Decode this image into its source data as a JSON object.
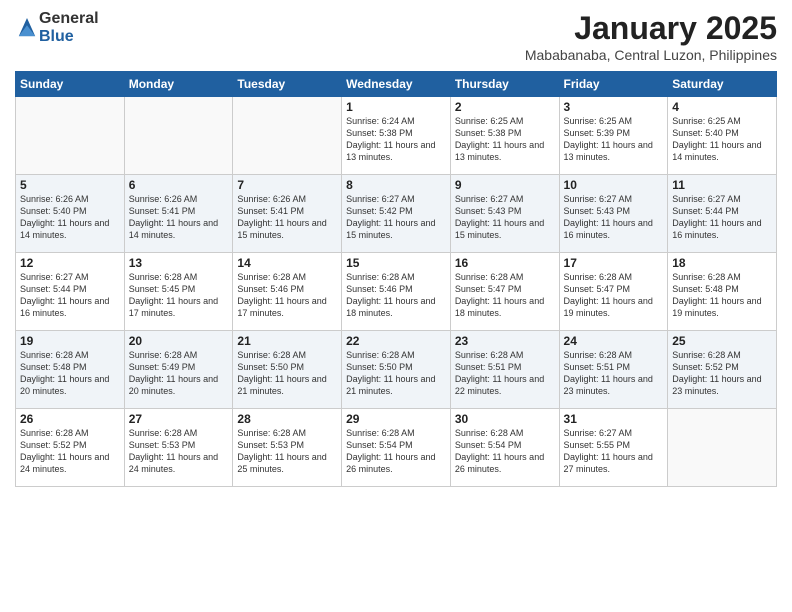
{
  "logo": {
    "general": "General",
    "blue": "Blue"
  },
  "header": {
    "month": "January 2025",
    "location": "Mababanaba, Central Luzon, Philippines"
  },
  "weekdays": [
    "Sunday",
    "Monday",
    "Tuesday",
    "Wednesday",
    "Thursday",
    "Friday",
    "Saturday"
  ],
  "weeks": [
    [
      {
        "day": "",
        "sunrise": "",
        "sunset": "",
        "daylight": ""
      },
      {
        "day": "",
        "sunrise": "",
        "sunset": "",
        "daylight": ""
      },
      {
        "day": "",
        "sunrise": "",
        "sunset": "",
        "daylight": ""
      },
      {
        "day": "1",
        "sunrise": "Sunrise: 6:24 AM",
        "sunset": "Sunset: 5:38 PM",
        "daylight": "Daylight: 11 hours and 13 minutes."
      },
      {
        "day": "2",
        "sunrise": "Sunrise: 6:25 AM",
        "sunset": "Sunset: 5:38 PM",
        "daylight": "Daylight: 11 hours and 13 minutes."
      },
      {
        "day": "3",
        "sunrise": "Sunrise: 6:25 AM",
        "sunset": "Sunset: 5:39 PM",
        "daylight": "Daylight: 11 hours and 13 minutes."
      },
      {
        "day": "4",
        "sunrise": "Sunrise: 6:25 AM",
        "sunset": "Sunset: 5:40 PM",
        "daylight": "Daylight: 11 hours and 14 minutes."
      }
    ],
    [
      {
        "day": "5",
        "sunrise": "Sunrise: 6:26 AM",
        "sunset": "Sunset: 5:40 PM",
        "daylight": "Daylight: 11 hours and 14 minutes."
      },
      {
        "day": "6",
        "sunrise": "Sunrise: 6:26 AM",
        "sunset": "Sunset: 5:41 PM",
        "daylight": "Daylight: 11 hours and 14 minutes."
      },
      {
        "day": "7",
        "sunrise": "Sunrise: 6:26 AM",
        "sunset": "Sunset: 5:41 PM",
        "daylight": "Daylight: 11 hours and 15 minutes."
      },
      {
        "day": "8",
        "sunrise": "Sunrise: 6:27 AM",
        "sunset": "Sunset: 5:42 PM",
        "daylight": "Daylight: 11 hours and 15 minutes."
      },
      {
        "day": "9",
        "sunrise": "Sunrise: 6:27 AM",
        "sunset": "Sunset: 5:43 PM",
        "daylight": "Daylight: 11 hours and 15 minutes."
      },
      {
        "day": "10",
        "sunrise": "Sunrise: 6:27 AM",
        "sunset": "Sunset: 5:43 PM",
        "daylight": "Daylight: 11 hours and 16 minutes."
      },
      {
        "day": "11",
        "sunrise": "Sunrise: 6:27 AM",
        "sunset": "Sunset: 5:44 PM",
        "daylight": "Daylight: 11 hours and 16 minutes."
      }
    ],
    [
      {
        "day": "12",
        "sunrise": "Sunrise: 6:27 AM",
        "sunset": "Sunset: 5:44 PM",
        "daylight": "Daylight: 11 hours and 16 minutes."
      },
      {
        "day": "13",
        "sunrise": "Sunrise: 6:28 AM",
        "sunset": "Sunset: 5:45 PM",
        "daylight": "Daylight: 11 hours and 17 minutes."
      },
      {
        "day": "14",
        "sunrise": "Sunrise: 6:28 AM",
        "sunset": "Sunset: 5:46 PM",
        "daylight": "Daylight: 11 hours and 17 minutes."
      },
      {
        "day": "15",
        "sunrise": "Sunrise: 6:28 AM",
        "sunset": "Sunset: 5:46 PM",
        "daylight": "Daylight: 11 hours and 18 minutes."
      },
      {
        "day": "16",
        "sunrise": "Sunrise: 6:28 AM",
        "sunset": "Sunset: 5:47 PM",
        "daylight": "Daylight: 11 hours and 18 minutes."
      },
      {
        "day": "17",
        "sunrise": "Sunrise: 6:28 AM",
        "sunset": "Sunset: 5:47 PM",
        "daylight": "Daylight: 11 hours and 19 minutes."
      },
      {
        "day": "18",
        "sunrise": "Sunrise: 6:28 AM",
        "sunset": "Sunset: 5:48 PM",
        "daylight": "Daylight: 11 hours and 19 minutes."
      }
    ],
    [
      {
        "day": "19",
        "sunrise": "Sunrise: 6:28 AM",
        "sunset": "Sunset: 5:48 PM",
        "daylight": "Daylight: 11 hours and 20 minutes."
      },
      {
        "day": "20",
        "sunrise": "Sunrise: 6:28 AM",
        "sunset": "Sunset: 5:49 PM",
        "daylight": "Daylight: 11 hours and 20 minutes."
      },
      {
        "day": "21",
        "sunrise": "Sunrise: 6:28 AM",
        "sunset": "Sunset: 5:50 PM",
        "daylight": "Daylight: 11 hours and 21 minutes."
      },
      {
        "day": "22",
        "sunrise": "Sunrise: 6:28 AM",
        "sunset": "Sunset: 5:50 PM",
        "daylight": "Daylight: 11 hours and 21 minutes."
      },
      {
        "day": "23",
        "sunrise": "Sunrise: 6:28 AM",
        "sunset": "Sunset: 5:51 PM",
        "daylight": "Daylight: 11 hours and 22 minutes."
      },
      {
        "day": "24",
        "sunrise": "Sunrise: 6:28 AM",
        "sunset": "Sunset: 5:51 PM",
        "daylight": "Daylight: 11 hours and 23 minutes."
      },
      {
        "day": "25",
        "sunrise": "Sunrise: 6:28 AM",
        "sunset": "Sunset: 5:52 PM",
        "daylight": "Daylight: 11 hours and 23 minutes."
      }
    ],
    [
      {
        "day": "26",
        "sunrise": "Sunrise: 6:28 AM",
        "sunset": "Sunset: 5:52 PM",
        "daylight": "Daylight: 11 hours and 24 minutes."
      },
      {
        "day": "27",
        "sunrise": "Sunrise: 6:28 AM",
        "sunset": "Sunset: 5:53 PM",
        "daylight": "Daylight: 11 hours and 24 minutes."
      },
      {
        "day": "28",
        "sunrise": "Sunrise: 6:28 AM",
        "sunset": "Sunset: 5:53 PM",
        "daylight": "Daylight: 11 hours and 25 minutes."
      },
      {
        "day": "29",
        "sunrise": "Sunrise: 6:28 AM",
        "sunset": "Sunset: 5:54 PM",
        "daylight": "Daylight: 11 hours and 26 minutes."
      },
      {
        "day": "30",
        "sunrise": "Sunrise: 6:28 AM",
        "sunset": "Sunset: 5:54 PM",
        "daylight": "Daylight: 11 hours and 26 minutes."
      },
      {
        "day": "31",
        "sunrise": "Sunrise: 6:27 AM",
        "sunset": "Sunset: 5:55 PM",
        "daylight": "Daylight: 11 hours and 27 minutes."
      },
      {
        "day": "",
        "sunrise": "",
        "sunset": "",
        "daylight": ""
      }
    ]
  ]
}
